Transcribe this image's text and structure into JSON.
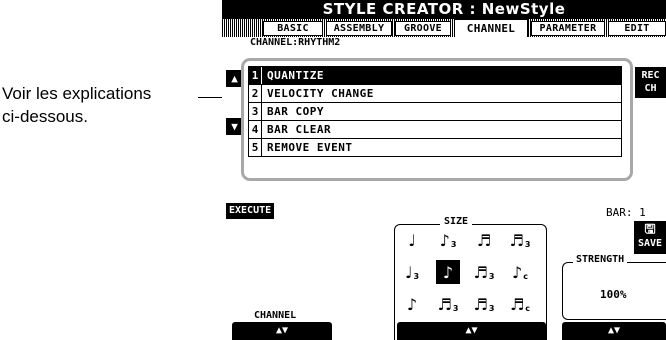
{
  "callout": {
    "line1": "Voir les explications",
    "line2": "ci-dessous."
  },
  "screen": {
    "title": "STYLE CREATOR : NewStyle",
    "tabs": [
      "BASIC",
      "ASSEMBLY",
      "GROOVE",
      "CHANNEL",
      "PARAMETER",
      "EDIT"
    ],
    "active_tab": "CHANNEL",
    "channel_title": "CHANNEL:RHYTHM2",
    "up_arrow": "▲",
    "down_arrow": "▼",
    "menu": [
      {
        "num": "1",
        "label": "QUANTIZE"
      },
      {
        "num": "2",
        "label": "VELOCITY CHANGE"
      },
      {
        "num": "3",
        "label": "BAR COPY"
      },
      {
        "num": "4",
        "label": "BAR CLEAR"
      },
      {
        "num": "5",
        "label": "REMOVE EVENT"
      }
    ],
    "rec_ch": {
      "line1": "REC",
      "line2": "CH"
    },
    "bar_label": "BAR:  1",
    "execute": "EXECUTE",
    "save": "SAVE",
    "save_icon": "floppy-disk-icon",
    "size_title": "SIZE",
    "size_grid": [
      {
        "glyph": "♩",
        "sub": ""
      },
      {
        "glyph": "♪",
        "sub": "3"
      },
      {
        "glyph": "♬",
        "sub": ""
      },
      {
        "glyph": "♬",
        "sub": "3"
      },
      {
        "glyph": "♩",
        "sub": "3"
      },
      {
        "glyph": "♪",
        "sub": ""
      },
      {
        "glyph": "♬",
        "sub": "3"
      },
      {
        "glyph": "♪",
        "sub": "c"
      },
      {
        "glyph": "♪",
        "sub": ""
      },
      {
        "glyph": "♬",
        "sub": "3"
      },
      {
        "glyph": "♬",
        "sub": "3"
      },
      {
        "glyph": "♬",
        "sub": "c"
      }
    ],
    "size_selected": 5,
    "strength_title": "STRENGTH",
    "strength_value": "100%",
    "channel_label": "CHANNEL",
    "dial": "▲▼"
  }
}
